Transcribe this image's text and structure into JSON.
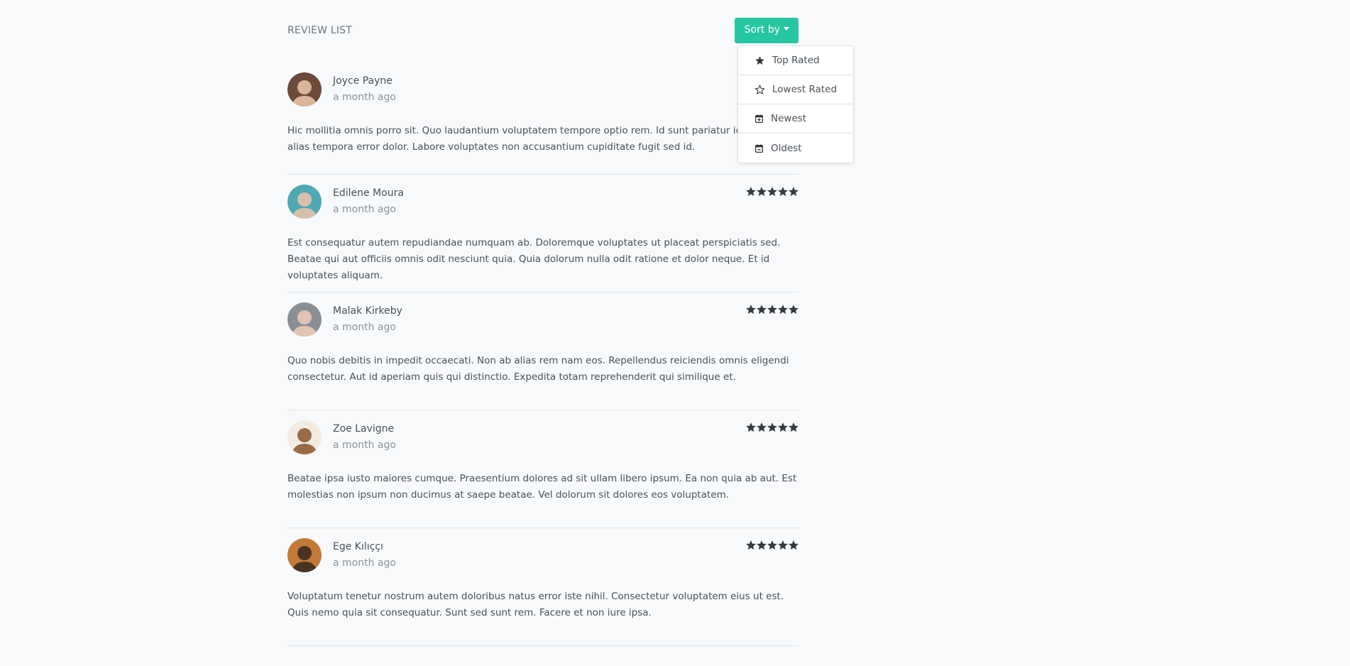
{
  "header": {
    "title": "REVIEW LIST",
    "sort_label": "Sort by"
  },
  "sort_menu": {
    "items": [
      {
        "label": "Top Rated",
        "icon": "star-solid-icon"
      },
      {
        "label": "Lowest Rated",
        "icon": "star-outline-icon"
      },
      {
        "label": "Newest",
        "icon": "calendar-plus-icon"
      },
      {
        "label": "Oldest",
        "icon": "calendar-minus-icon"
      }
    ]
  },
  "reviews": [
    {
      "name": "Joyce Payne",
      "time": "a month ago",
      "rating": 5,
      "text": "Hic mollitia omnis porro sit. Quo laudantium voluptatem tempore optio rem. Id sunt pariatur id vero et alias tempora error dolor. Labore voluptates non accusantium cupiditate fugit sed id.",
      "avatar_colors": [
        "#6b4a3a",
        "#d9b59a"
      ]
    },
    {
      "name": "Edilene Moura",
      "time": "a month ago",
      "rating": 5,
      "text": "Est consequatur autem repudiandae numquam ab. Doloremque voluptates ut placeat perspiciatis sed. Beatae qui aut officiis omnis odit nesciunt quia. Quia dolorum nulla odit ratione et dolor neque. Et id voluptates aliquam.",
      "avatar_colors": [
        "#4fa9b3",
        "#d6c0ad"
      ]
    },
    {
      "name": "Malak Kirkeby",
      "time": "a month ago",
      "rating": 5,
      "text": "Quo nobis debitis in impedit occaecati. Non ab alias rem nam eos. Repellendus reiciendis omnis eligendi consectetur. Aut id aperiam quis qui distinctio. Expedita totam reprehenderit qui similique et.",
      "avatar_colors": [
        "#8a8f95",
        "#e2c4b4"
      ]
    },
    {
      "name": "Zoe Lavigne",
      "time": "a month ago",
      "rating": 5,
      "text": "Beatae ipsa iusto maiores cumque. Praesentium dolores ad sit ullam libero ipsum. Ea non quia ab aut. Est molestias non ipsum non ducimus at saepe beatae. Vel dolorum sit dolores eos voluptatem.",
      "avatar_colors": [
        "#f1ebe3",
        "#9b6a47"
      ]
    },
    {
      "name": "Ege Kılıççı",
      "time": "a month ago",
      "rating": 5,
      "text": "Voluptatum tenetur nostrum autem doloribus natus error iste nihil. Consectetur voluptatem eius ut est. Quis nemo quia sit consequatur. Sunt sed sunt rem. Facere et non iure ipsa.",
      "avatar_colors": [
        "#c07a36",
        "#4a3222"
      ]
    }
  ],
  "colors": {
    "accent": "#26c6a2",
    "star": "#343a40",
    "background": "#f8f9fa"
  }
}
